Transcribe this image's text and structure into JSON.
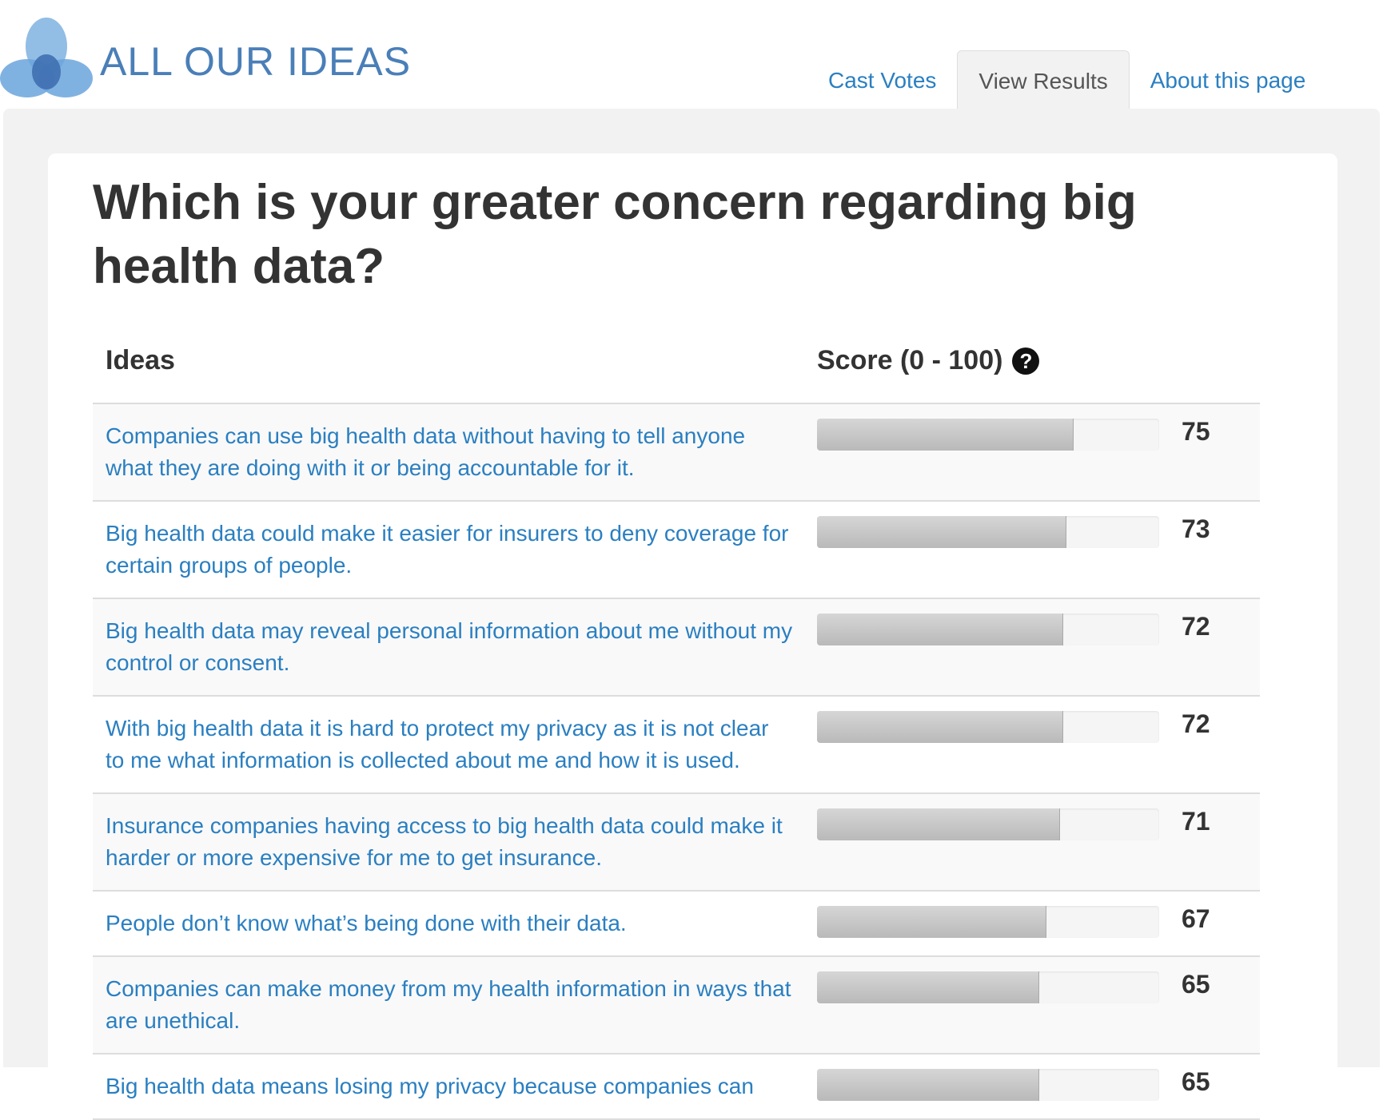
{
  "brand": {
    "logo_text": "ALL OUR IDEAS"
  },
  "tabs": [
    {
      "label": "Cast Votes",
      "active": false
    },
    {
      "label": "View Results",
      "active": true
    },
    {
      "label": "About this page",
      "active": false
    }
  ],
  "question": "Which is your greater concern regarding big health data?",
  "table": {
    "headers": {
      "ideas": "Ideas",
      "score": "Score (0 - 100)"
    },
    "help_icon": "question-mark-icon",
    "rows": [
      {
        "idea": "Companies can use big health data without having to tell anyone what they are doing with it or being accountable for it.",
        "score": 75
      },
      {
        "idea": "Big health data could make it easier for insurers to deny coverage for certain groups of people.",
        "score": 73
      },
      {
        "idea": "Big health data may reveal personal information about me without my control or consent.",
        "score": 72
      },
      {
        "idea": "With big health data it is hard to protect my privacy as it is not clear to me what information is collected about me and how it is used.",
        "score": 72
      },
      {
        "idea": "Insurance companies having access to big health data could make it harder or more expensive for me to get insurance.",
        "score": 71
      },
      {
        "idea": "People don’t know what’s being done with their data.",
        "score": 67
      },
      {
        "idea": "Companies can make money from my health information in ways that are unethical.",
        "score": 65
      },
      {
        "idea": "Big health data means losing my privacy because companies can",
        "score": 65
      }
    ]
  },
  "colors": {
    "link": "#2a7fc1",
    "logo_text": "#4a7fb8",
    "panel_bg": "#f2f2f2",
    "bar_fill": "#c4c4c4",
    "row_stripe": "#f9f9f9"
  }
}
